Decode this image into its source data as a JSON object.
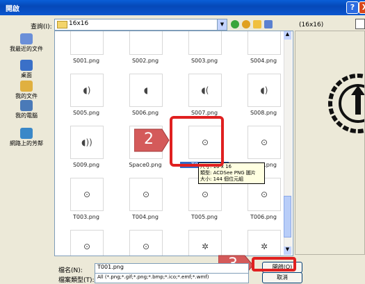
{
  "window": {
    "title": "開啟",
    "help": "?",
    "close": "X"
  },
  "lookin": {
    "label": "查詢(I):",
    "value": "16x16"
  },
  "preview": {
    "size_text": "(16x16)"
  },
  "places": [
    {
      "label": "我最近的文件",
      "color": "#6a8fd8"
    },
    {
      "label": "桌面",
      "color": "#3a70c8"
    },
    {
      "label": "我的文件",
      "color": "#e0b040"
    },
    {
      "label": "我的電腦",
      "color": "#4a7ab8"
    },
    {
      "label": "網路上的芳鄰",
      "color": "#3a88c8"
    }
  ],
  "files": [
    {
      "name": "S001.png",
      "glyph": ""
    },
    {
      "name": "S002.png",
      "glyph": ""
    },
    {
      "name": "S003.png",
      "glyph": ""
    },
    {
      "name": "S004.png",
      "glyph": ""
    },
    {
      "name": "S005.png",
      "glyph": "◖)"
    },
    {
      "name": "S006.png",
      "glyph": "◖"
    },
    {
      "name": "S007.png",
      "glyph": "◖("
    },
    {
      "name": "S008.png",
      "glyph": "◖)"
    },
    {
      "name": "S009.png",
      "glyph": "◖))"
    },
    {
      "name": "Space0.png",
      "glyph": ""
    },
    {
      "name": "T001.png",
      "glyph": "⊙"
    },
    {
      "name": "T002.png",
      "glyph": "⊙"
    },
    {
      "name": "T003.png",
      "glyph": "⊙"
    },
    {
      "name": "T004.png",
      "glyph": "⊙"
    },
    {
      "name": "T005.png",
      "glyph": "⊙"
    },
    {
      "name": "T006.png",
      "glyph": "⊙"
    },
    {
      "name": "",
      "glyph": "⊙"
    },
    {
      "name": "",
      "glyph": "⊙"
    },
    {
      "name": "",
      "glyph": "✲"
    },
    {
      "name": "",
      "glyph": "✲"
    }
  ],
  "tooltip": {
    "line1": "尺寸: 16 x 16",
    "line2": "類型: ACDSee PNG 圖片",
    "line3": "大小: 144 個位元組"
  },
  "callouts": {
    "step2": "2",
    "step3": "3"
  },
  "filename": {
    "label": "檔名(N):",
    "value": "T001.png"
  },
  "filetype": {
    "label": "檔案類型(T):",
    "value": "All (*.png;*.gif;*.png;*.bmp;*.ico;*.emf;*.wmf)"
  },
  "buttons": {
    "open": "開啟(O)",
    "cancel": "取消"
  },
  "colors": {
    "titlebar": "#0548b8",
    "highlight": "#e02020",
    "callout": "#d45a5a"
  }
}
